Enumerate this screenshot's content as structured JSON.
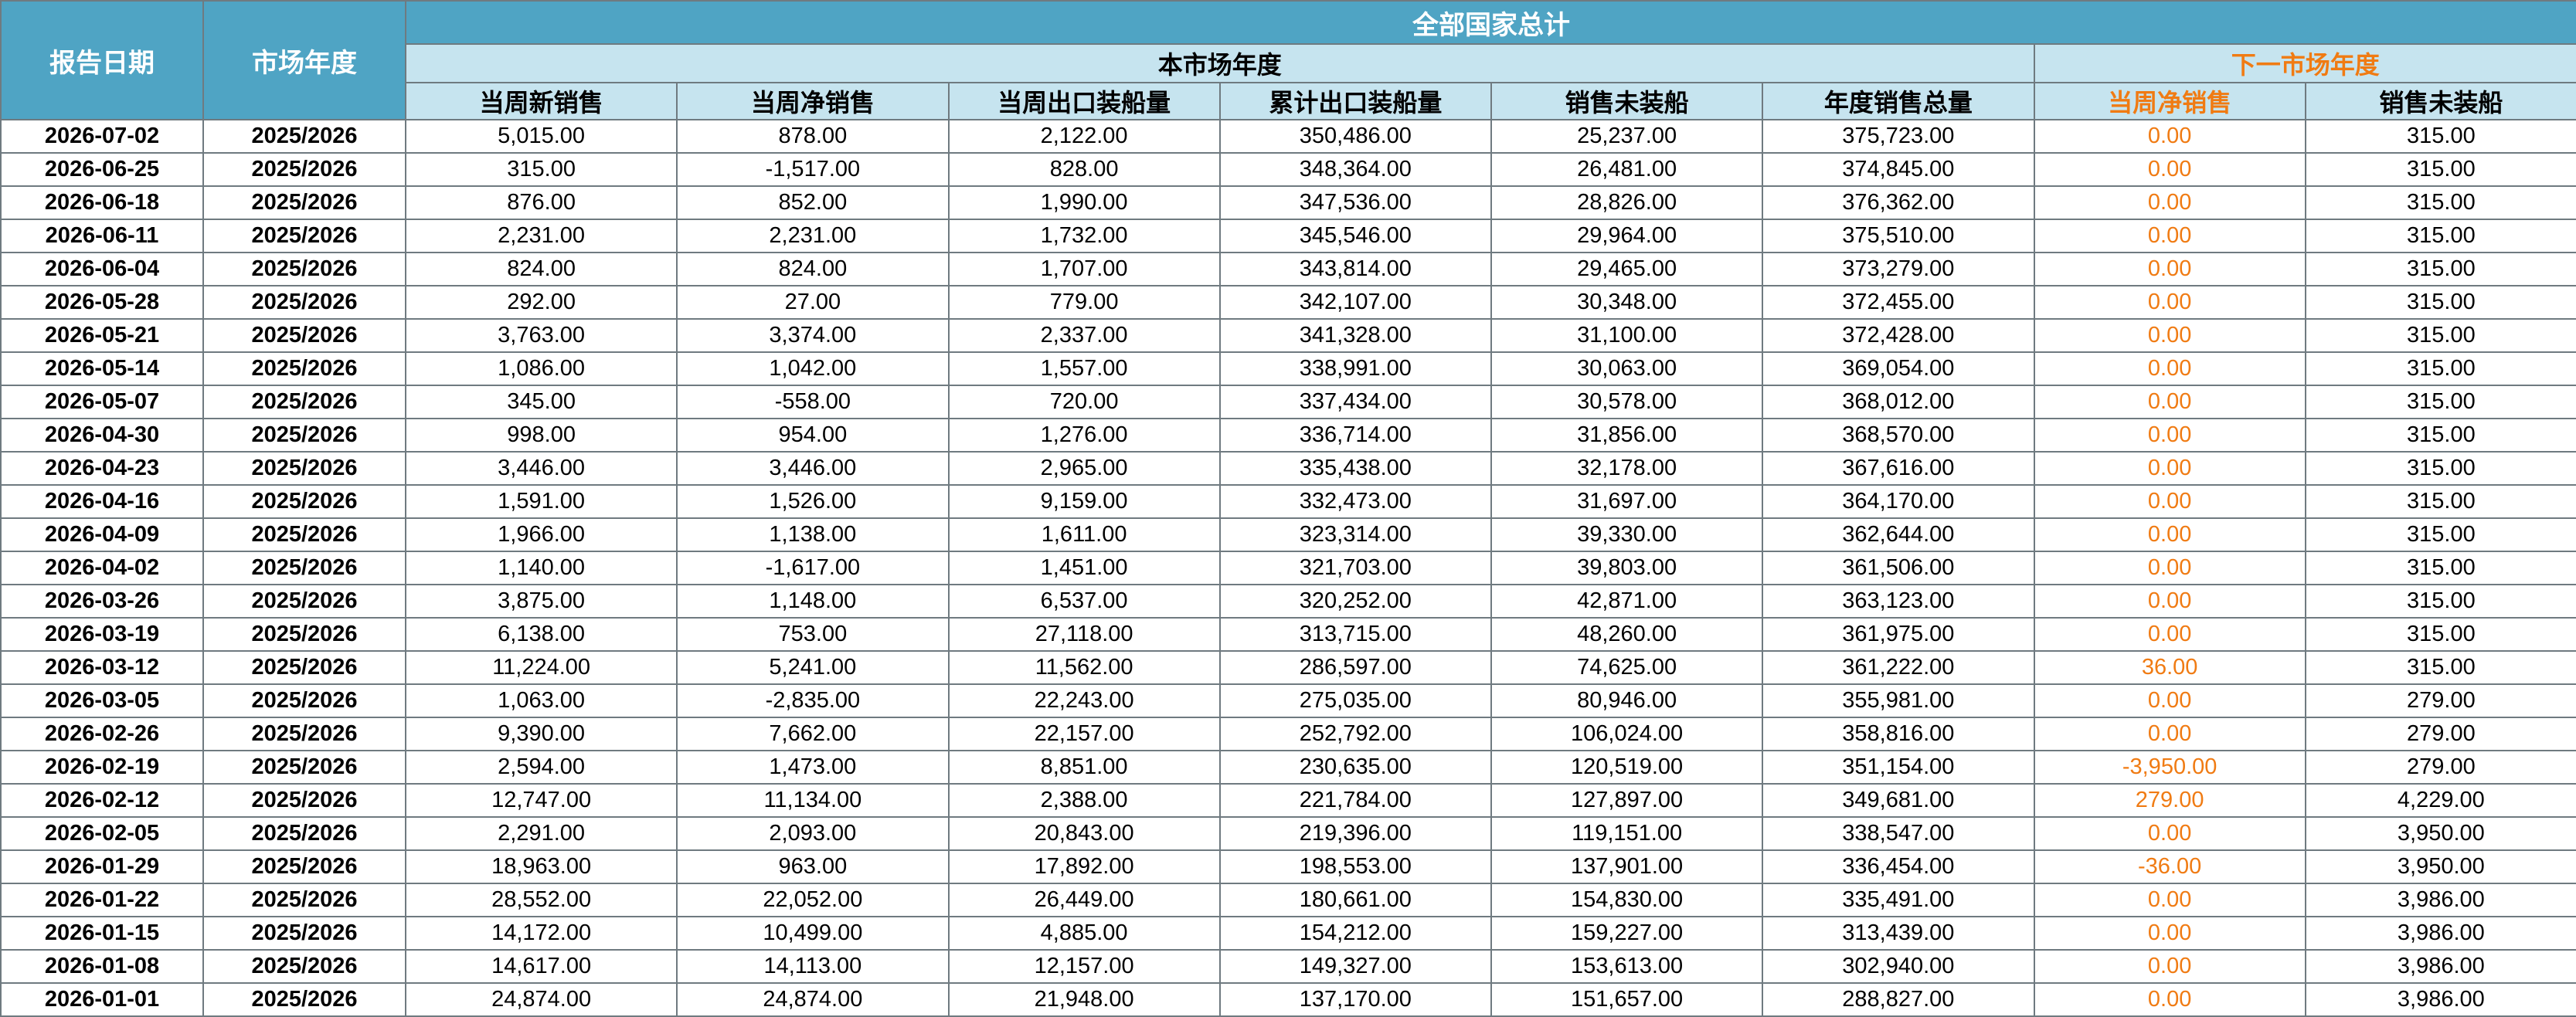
{
  "header": {
    "report_date": "报告日期",
    "market_year": "市场年度",
    "all_countries_total": "全部国家总计",
    "this_market_year": "本市场年度",
    "next_market_year": "下一市场年度",
    "columns": [
      "当周新销售",
      "当周净销售",
      "当周出口装船量",
      "累计出口装船量",
      "销售未装船",
      "年度销售总量",
      "当周净销售",
      "销售未装船"
    ]
  },
  "colors": {
    "header_dark": "#4fa4c4",
    "header_light": "#c6e4ef",
    "accent_orange": "#f07b13"
  },
  "rows": [
    [
      "2026-07-02",
      "2025/2026",
      "5,015.00",
      "878.00",
      "2,122.00",
      "350,486.00",
      "25,237.00",
      "375,723.00",
      "0.00",
      "315.00"
    ],
    [
      "2026-06-25",
      "2025/2026",
      "315.00",
      "-1,517.00",
      "828.00",
      "348,364.00",
      "26,481.00",
      "374,845.00",
      "0.00",
      "315.00"
    ],
    [
      "2026-06-18",
      "2025/2026",
      "876.00",
      "852.00",
      "1,990.00",
      "347,536.00",
      "28,826.00",
      "376,362.00",
      "0.00",
      "315.00"
    ],
    [
      "2026-06-11",
      "2025/2026",
      "2,231.00",
      "2,231.00",
      "1,732.00",
      "345,546.00",
      "29,964.00",
      "375,510.00",
      "0.00",
      "315.00"
    ],
    [
      "2026-06-04",
      "2025/2026",
      "824.00",
      "824.00",
      "1,707.00",
      "343,814.00",
      "29,465.00",
      "373,279.00",
      "0.00",
      "315.00"
    ],
    [
      "2026-05-28",
      "2025/2026",
      "292.00",
      "27.00",
      "779.00",
      "342,107.00",
      "30,348.00",
      "372,455.00",
      "0.00",
      "315.00"
    ],
    [
      "2026-05-21",
      "2025/2026",
      "3,763.00",
      "3,374.00",
      "2,337.00",
      "341,328.00",
      "31,100.00",
      "372,428.00",
      "0.00",
      "315.00"
    ],
    [
      "2026-05-14",
      "2025/2026",
      "1,086.00",
      "1,042.00",
      "1,557.00",
      "338,991.00",
      "30,063.00",
      "369,054.00",
      "0.00",
      "315.00"
    ],
    [
      "2026-05-07",
      "2025/2026",
      "345.00",
      "-558.00",
      "720.00",
      "337,434.00",
      "30,578.00",
      "368,012.00",
      "0.00",
      "315.00"
    ],
    [
      "2026-04-30",
      "2025/2026",
      "998.00",
      "954.00",
      "1,276.00",
      "336,714.00",
      "31,856.00",
      "368,570.00",
      "0.00",
      "315.00"
    ],
    [
      "2026-04-23",
      "2025/2026",
      "3,446.00",
      "3,446.00",
      "2,965.00",
      "335,438.00",
      "32,178.00",
      "367,616.00",
      "0.00",
      "315.00"
    ],
    [
      "2026-04-16",
      "2025/2026",
      "1,591.00",
      "1,526.00",
      "9,159.00",
      "332,473.00",
      "31,697.00",
      "364,170.00",
      "0.00",
      "315.00"
    ],
    [
      "2026-04-09",
      "2025/2026",
      "1,966.00",
      "1,138.00",
      "1,611.00",
      "323,314.00",
      "39,330.00",
      "362,644.00",
      "0.00",
      "315.00"
    ],
    [
      "2026-04-02",
      "2025/2026",
      "1,140.00",
      "-1,617.00",
      "1,451.00",
      "321,703.00",
      "39,803.00",
      "361,506.00",
      "0.00",
      "315.00"
    ],
    [
      "2026-03-26",
      "2025/2026",
      "3,875.00",
      "1,148.00",
      "6,537.00",
      "320,252.00",
      "42,871.00",
      "363,123.00",
      "0.00",
      "315.00"
    ],
    [
      "2026-03-19",
      "2025/2026",
      "6,138.00",
      "753.00",
      "27,118.00",
      "313,715.00",
      "48,260.00",
      "361,975.00",
      "0.00",
      "315.00"
    ],
    [
      "2026-03-12",
      "2025/2026",
      "11,224.00",
      "5,241.00",
      "11,562.00",
      "286,597.00",
      "74,625.00",
      "361,222.00",
      "36.00",
      "315.00"
    ],
    [
      "2026-03-05",
      "2025/2026",
      "1,063.00",
      "-2,835.00",
      "22,243.00",
      "275,035.00",
      "80,946.00",
      "355,981.00",
      "0.00",
      "279.00"
    ],
    [
      "2026-02-26",
      "2025/2026",
      "9,390.00",
      "7,662.00",
      "22,157.00",
      "252,792.00",
      "106,024.00",
      "358,816.00",
      "0.00",
      "279.00"
    ],
    [
      "2026-02-19",
      "2025/2026",
      "2,594.00",
      "1,473.00",
      "8,851.00",
      "230,635.00",
      "120,519.00",
      "351,154.00",
      "-3,950.00",
      "279.00"
    ],
    [
      "2026-02-12",
      "2025/2026",
      "12,747.00",
      "11,134.00",
      "2,388.00",
      "221,784.00",
      "127,897.00",
      "349,681.00",
      "279.00",
      "4,229.00"
    ],
    [
      "2026-02-05",
      "2025/2026",
      "2,291.00",
      "2,093.00",
      "20,843.00",
      "219,396.00",
      "119,151.00",
      "338,547.00",
      "0.00",
      "3,950.00"
    ],
    [
      "2026-01-29",
      "2025/2026",
      "18,963.00",
      "963.00",
      "17,892.00",
      "198,553.00",
      "137,901.00",
      "336,454.00",
      "-36.00",
      "3,950.00"
    ],
    [
      "2026-01-22",
      "2025/2026",
      "28,552.00",
      "22,052.00",
      "26,449.00",
      "180,661.00",
      "154,830.00",
      "335,491.00",
      "0.00",
      "3,986.00"
    ],
    [
      "2026-01-15",
      "2025/2026",
      "14,172.00",
      "10,499.00",
      "4,885.00",
      "154,212.00",
      "159,227.00",
      "313,439.00",
      "0.00",
      "3,986.00"
    ],
    [
      "2026-01-08",
      "2025/2026",
      "14,617.00",
      "14,113.00",
      "12,157.00",
      "149,327.00",
      "153,613.00",
      "302,940.00",
      "0.00",
      "3,986.00"
    ],
    [
      "2026-01-01",
      "2025/2026",
      "24,874.00",
      "24,874.00",
      "21,948.00",
      "137,170.00",
      "151,657.00",
      "288,827.00",
      "0.00",
      "3,986.00"
    ]
  ]
}
